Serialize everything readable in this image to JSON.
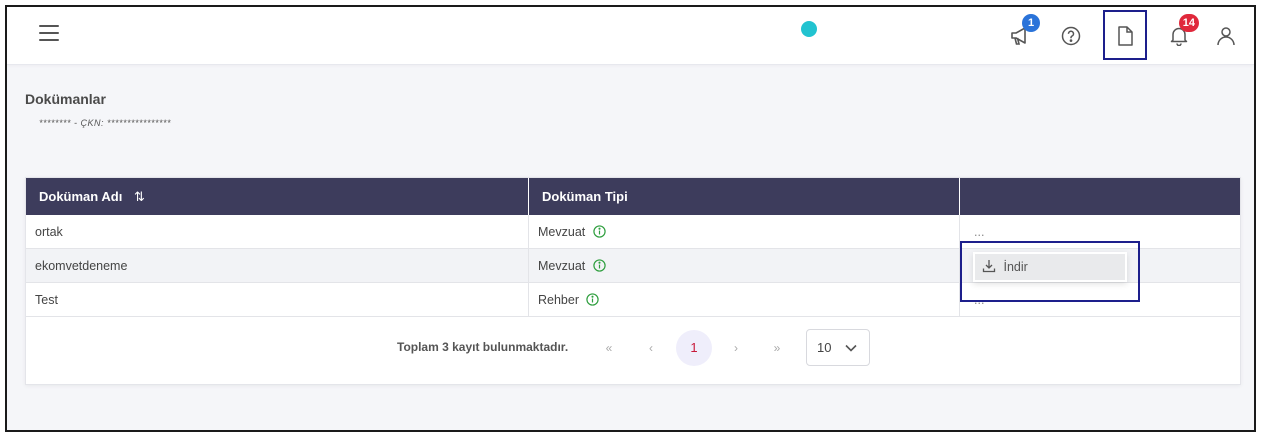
{
  "header": {
    "notification_count": "1",
    "alert_count": "14"
  },
  "page": {
    "title": "Dokümanlar",
    "subtitle": "********  - ÇKN: ****************"
  },
  "table": {
    "columns": [
      "Doküman Adı",
      "Doküman Tipi",
      ""
    ],
    "sort_icon": "⇅",
    "rows": [
      {
        "name": "ortak",
        "type": "Mevzuat",
        "action": "..."
      },
      {
        "name": "ekomvetdeneme",
        "type": "Mevzuat",
        "action": "..."
      },
      {
        "name": "Test",
        "type": "Rehber",
        "action": "..."
      }
    ]
  },
  "dropdown": {
    "download_label": "İndir"
  },
  "pagination": {
    "total_text": "Toplam 3 kayıt bulunmaktadır.",
    "first": "«",
    "prev": "‹",
    "current_page": "1",
    "next": "›",
    "last": "»",
    "page_size": "10"
  },
  "colors": {
    "header_bg": "#3d3c5c",
    "accent_dot": "#22c3d0",
    "badge_blue": "#2a73d9",
    "badge_red": "#e0283b",
    "highlight": "#1d1f8c",
    "info_green": "#2e9e3e"
  },
  "icons": {
    "menu": "hamburger-icon",
    "announcement": "megaphone-icon",
    "help": "question-circle-icon",
    "documents": "file-icon",
    "notifications": "bell-icon",
    "user": "user-icon",
    "info": "info-circle-icon",
    "download": "download-icon",
    "chevron": "chevron-down-icon"
  }
}
